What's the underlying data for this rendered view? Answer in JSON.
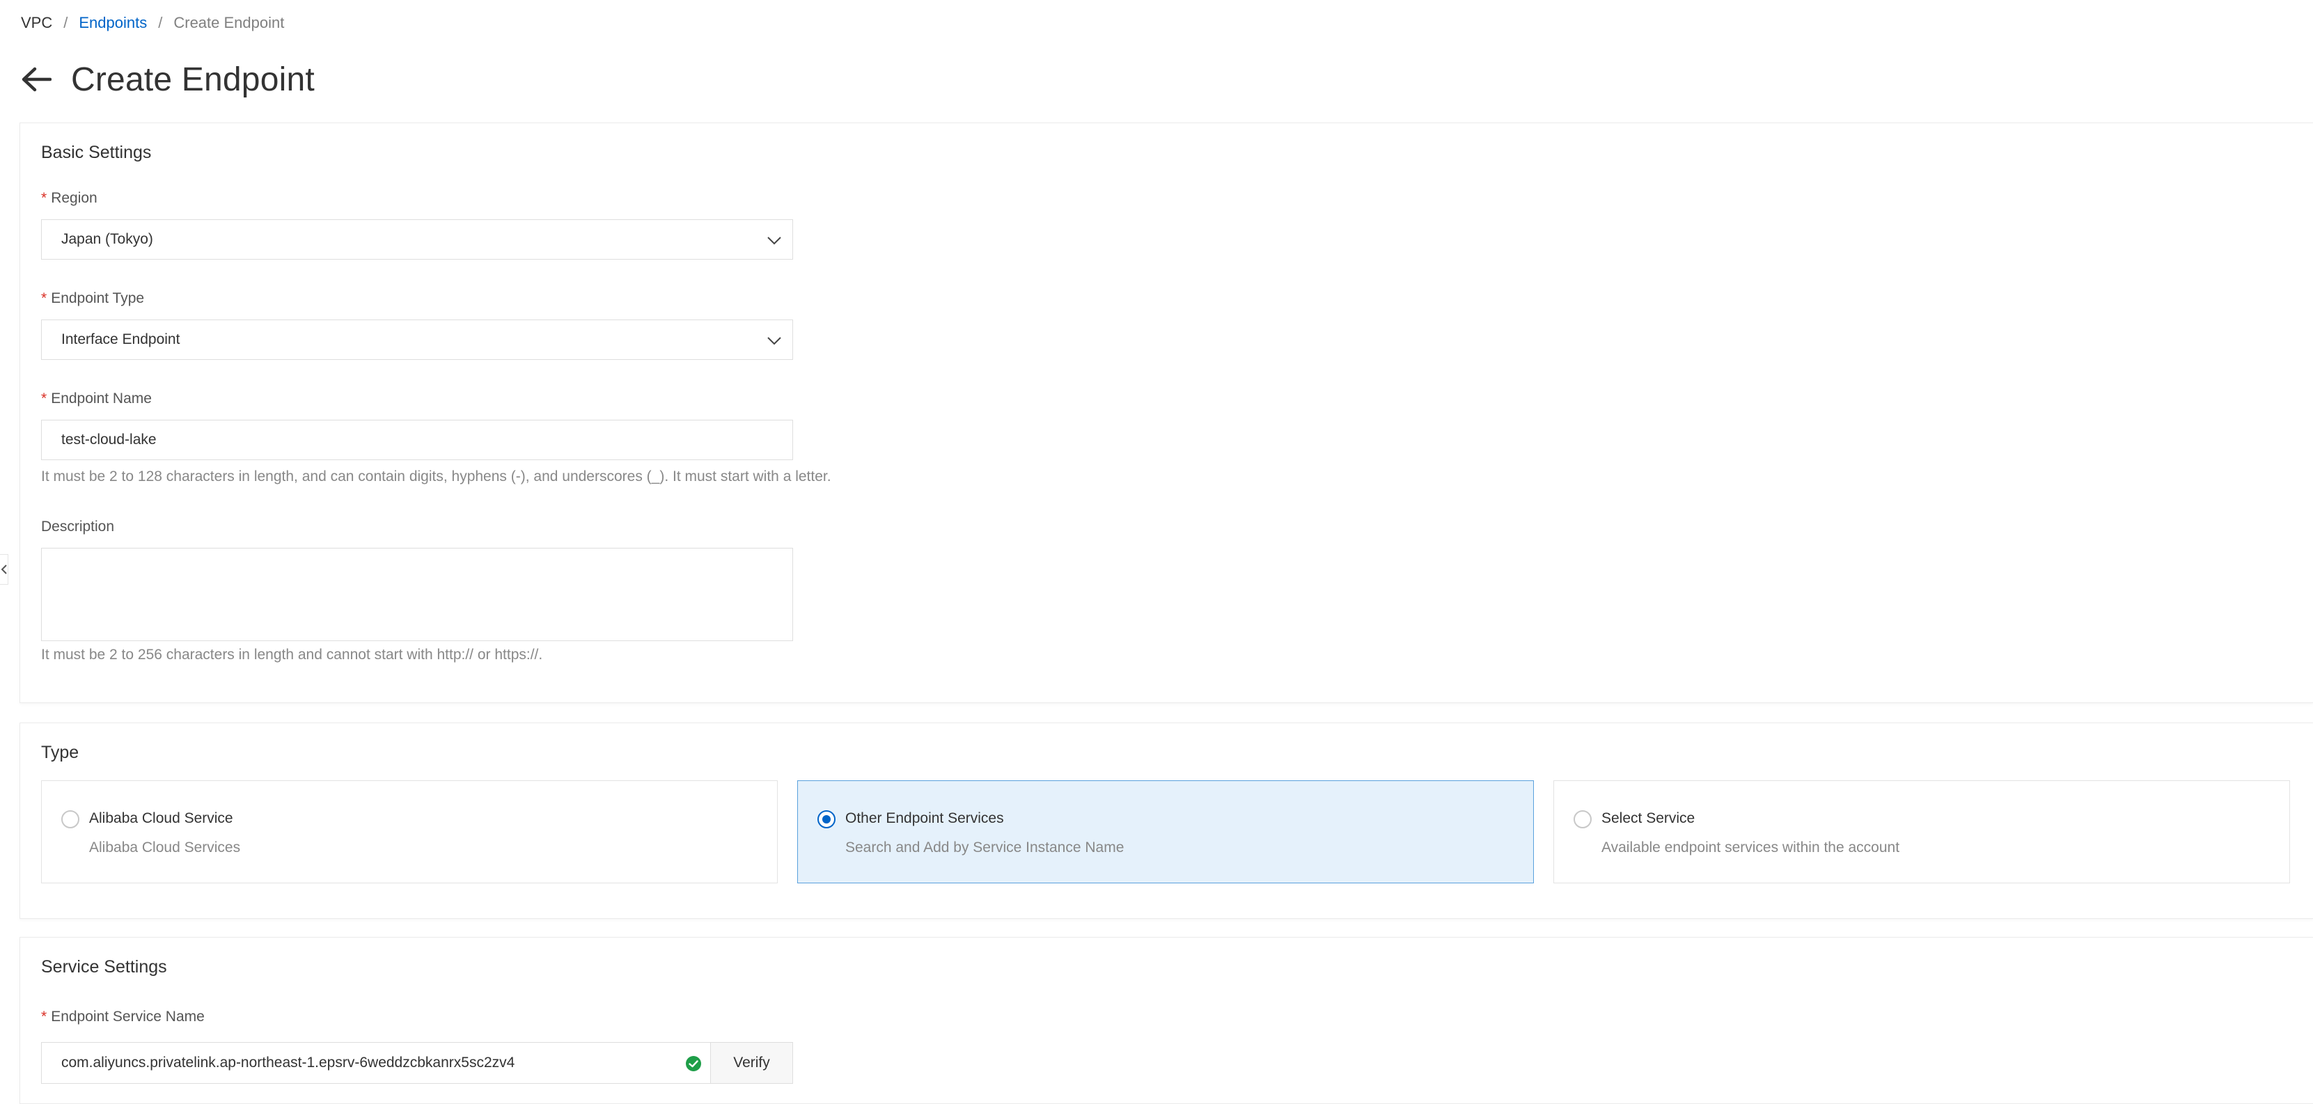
{
  "breadcrumb": {
    "root": "VPC",
    "separator": "/",
    "parent": "Endpoints",
    "current": "Create Endpoint"
  },
  "page": {
    "title": "Create Endpoint",
    "back_icon": "arrow-left-icon"
  },
  "basic_settings": {
    "title": "Basic Settings",
    "required_mark": "*",
    "region": {
      "label": "Region",
      "value": "Japan (Tokyo)"
    },
    "endpoint_type": {
      "label": "Endpoint Type",
      "value": "Interface Endpoint"
    },
    "endpoint_name": {
      "label": "Endpoint Name",
      "value": "test-cloud-lake",
      "help": "It must be 2 to 128 characters in length, and can contain digits, hyphens (-), and underscores (_). It must start with a letter."
    },
    "description": {
      "label": "Description",
      "value": "",
      "help": "It must be 2 to 256 characters in length and cannot start with http:// or https://."
    }
  },
  "type_section": {
    "title": "Type",
    "options": [
      {
        "title": "Alibaba Cloud Service",
        "description": "Alibaba Cloud Services",
        "selected": false
      },
      {
        "title": "Other Endpoint Services",
        "description": "Search and Add by Service Instance Name",
        "selected": true
      },
      {
        "title": "Select Service",
        "description": "Available endpoint services within the account",
        "selected": false
      }
    ]
  },
  "service_settings": {
    "title": "Service Settings",
    "required_mark": "*",
    "service_name": {
      "label": "Endpoint Service Name",
      "value": "com.aliyuncs.privatelink.ap-northeast-1.epsrv-6weddzcbkanrx5sc2zv4",
      "status_icon": "check-circle-icon"
    },
    "verify_label": "Verify"
  },
  "colors": {
    "link": "#0064c8",
    "required": "#d93026",
    "selected_bg": "#e5f1fb",
    "selected_border": "#5aa1dd",
    "success": "#1e9e48"
  }
}
